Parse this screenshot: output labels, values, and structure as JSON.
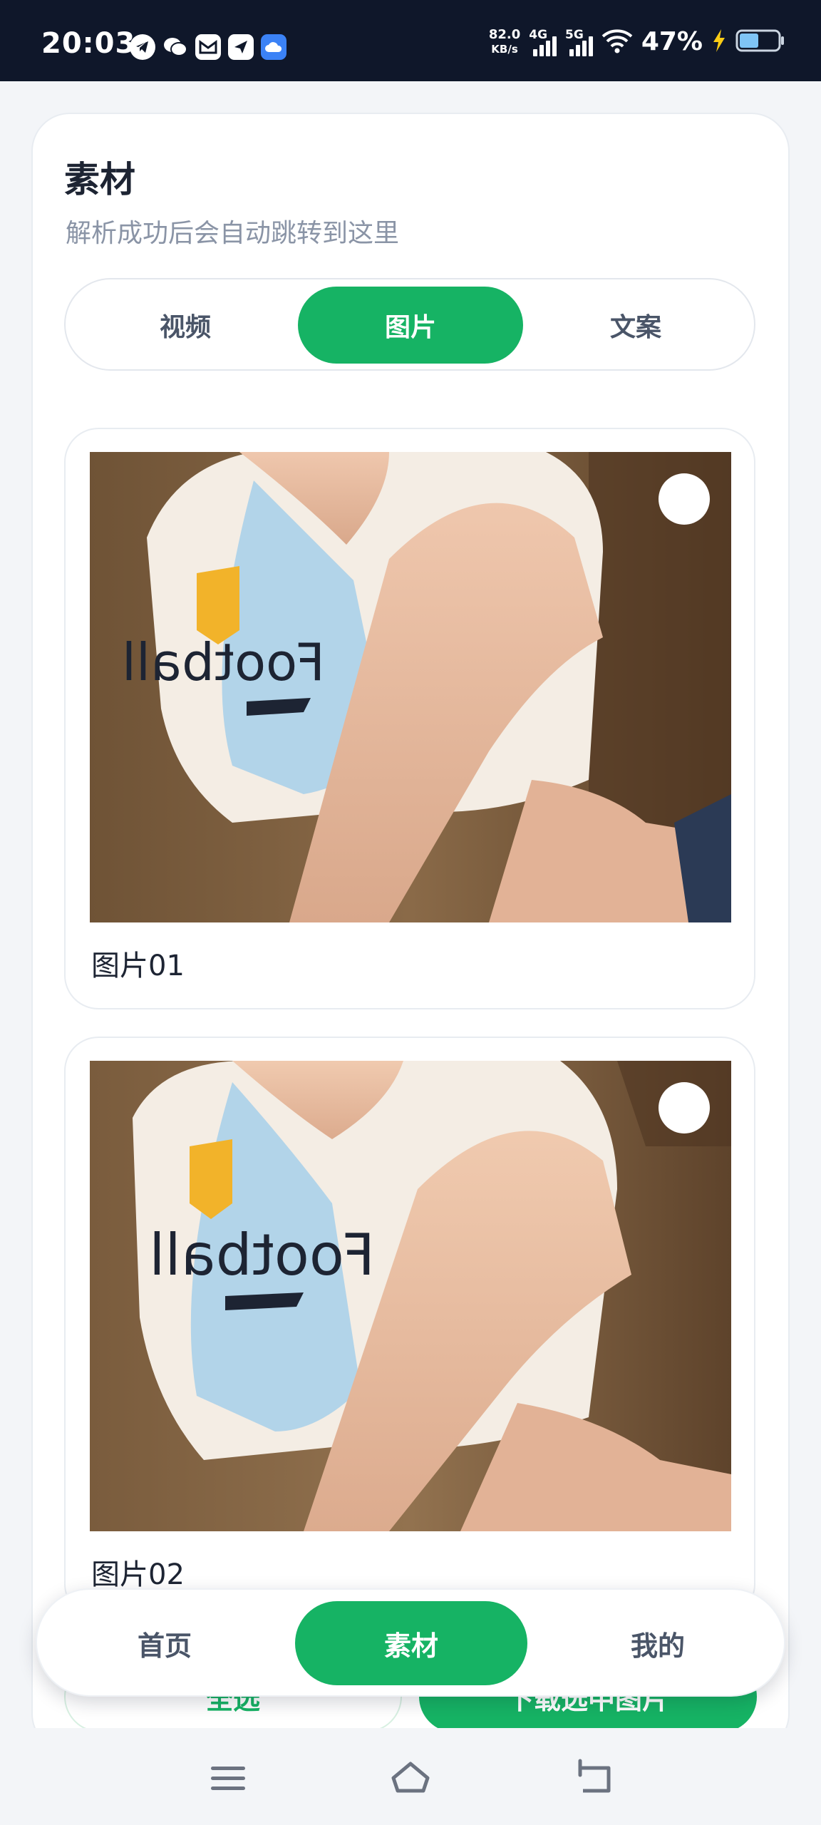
{
  "status_bar": {
    "time": "20:03",
    "net_speed_value": "82.0",
    "net_speed_unit": "KB/s",
    "net_4g": "4G",
    "net_5g": "5G",
    "battery": "47%",
    "app_icons": [
      "telegram-icon",
      "wechat-icon",
      "gmail-icon",
      "send-icon",
      "cloud-icon"
    ]
  },
  "page": {
    "title": "素材",
    "subtitle": "解析成功后会自动跳转到这里"
  },
  "tabs": [
    {
      "label": "视频",
      "active": false
    },
    {
      "label": "图片",
      "active": true
    },
    {
      "label": "文案",
      "active": false
    }
  ],
  "images": [
    {
      "label": "图片01",
      "selected": false
    },
    {
      "label": "图片02",
      "selected": false
    }
  ],
  "actions": {
    "select_all": "全选",
    "download_selected": "下载选中图片"
  },
  "bottom_nav": [
    {
      "label": "首页",
      "active": false
    },
    {
      "label": "素材",
      "active": true
    },
    {
      "label": "我的",
      "active": false
    }
  ],
  "colors": {
    "accent": "#16b364",
    "status_bar_bg": "#0f172a",
    "page_bg": "#f3f5f8"
  }
}
